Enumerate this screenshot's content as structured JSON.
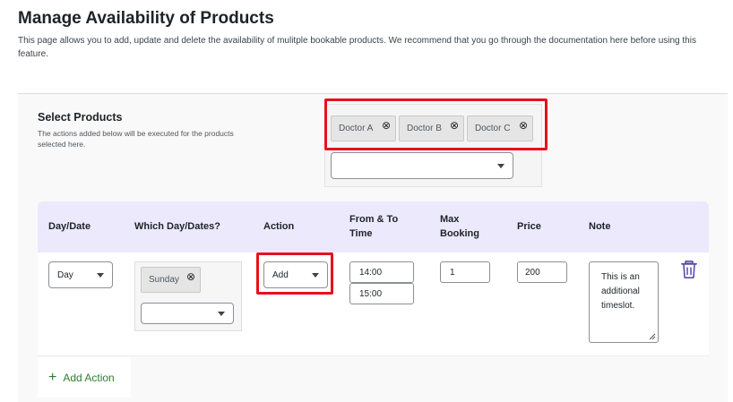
{
  "header": {
    "title": "Manage Availability of Products",
    "description": "This page allows you to add, update and delete the availability of mulitple bookable products. We recommend that you go through the documentation here before using this feature."
  },
  "select_products": {
    "title": "Select Products",
    "help": "The actions added below will be executed for the products selected here.",
    "tags": [
      "Doctor A",
      "Doctor B",
      "Doctor C"
    ],
    "dropdown_value": ""
  },
  "table": {
    "headers": {
      "day_date": "Day/Date",
      "which_days": "Which Day/Dates?",
      "action": "Action",
      "from_to_time": "From & To Time",
      "max_booking": "Max Booking",
      "price": "Price",
      "note": "Note"
    },
    "row": {
      "day_date": "Day",
      "which_days_tag": "Sunday",
      "which_days_dropdown": "",
      "action": "Add",
      "from_time": "14:00",
      "to_time": "15:00",
      "max_booking": "1",
      "price": "200",
      "note": "This is an additional timeslot."
    }
  },
  "add_action_label": "Add Action",
  "colors": {
    "highlight": "#e8101c",
    "header_bg": "#ece9fd",
    "trash": "#5b4ba8",
    "add_action": "#2e7d32"
  }
}
